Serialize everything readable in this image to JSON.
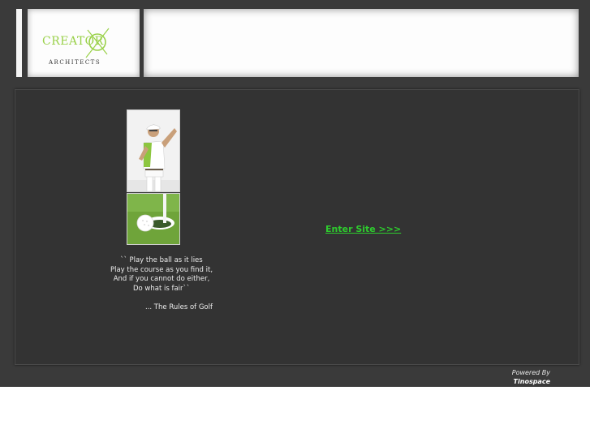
{
  "header": {
    "logo": {
      "word": "CREATOR",
      "subtitle": "ARCHITECTS"
    }
  },
  "main": {
    "quote_lines": [
      "`` Play the ball as it lies",
      "Play the course as you find it,",
      "And if you cannot do either,",
      "Do what is fair``"
    ],
    "quote_source": "... The Rules of Golf",
    "enter_link": "Enter Site >>>"
  },
  "footer": {
    "powered_by": "Powered By",
    "brand": "Tinospace"
  },
  "colors": {
    "accent_green": "#9ad14a",
    "link_green": "#2ecc2e",
    "dark_background": "#3a3a3a",
    "panel_background": "#333333"
  },
  "icons": {
    "logo_mark": "circle-cross-icon"
  }
}
